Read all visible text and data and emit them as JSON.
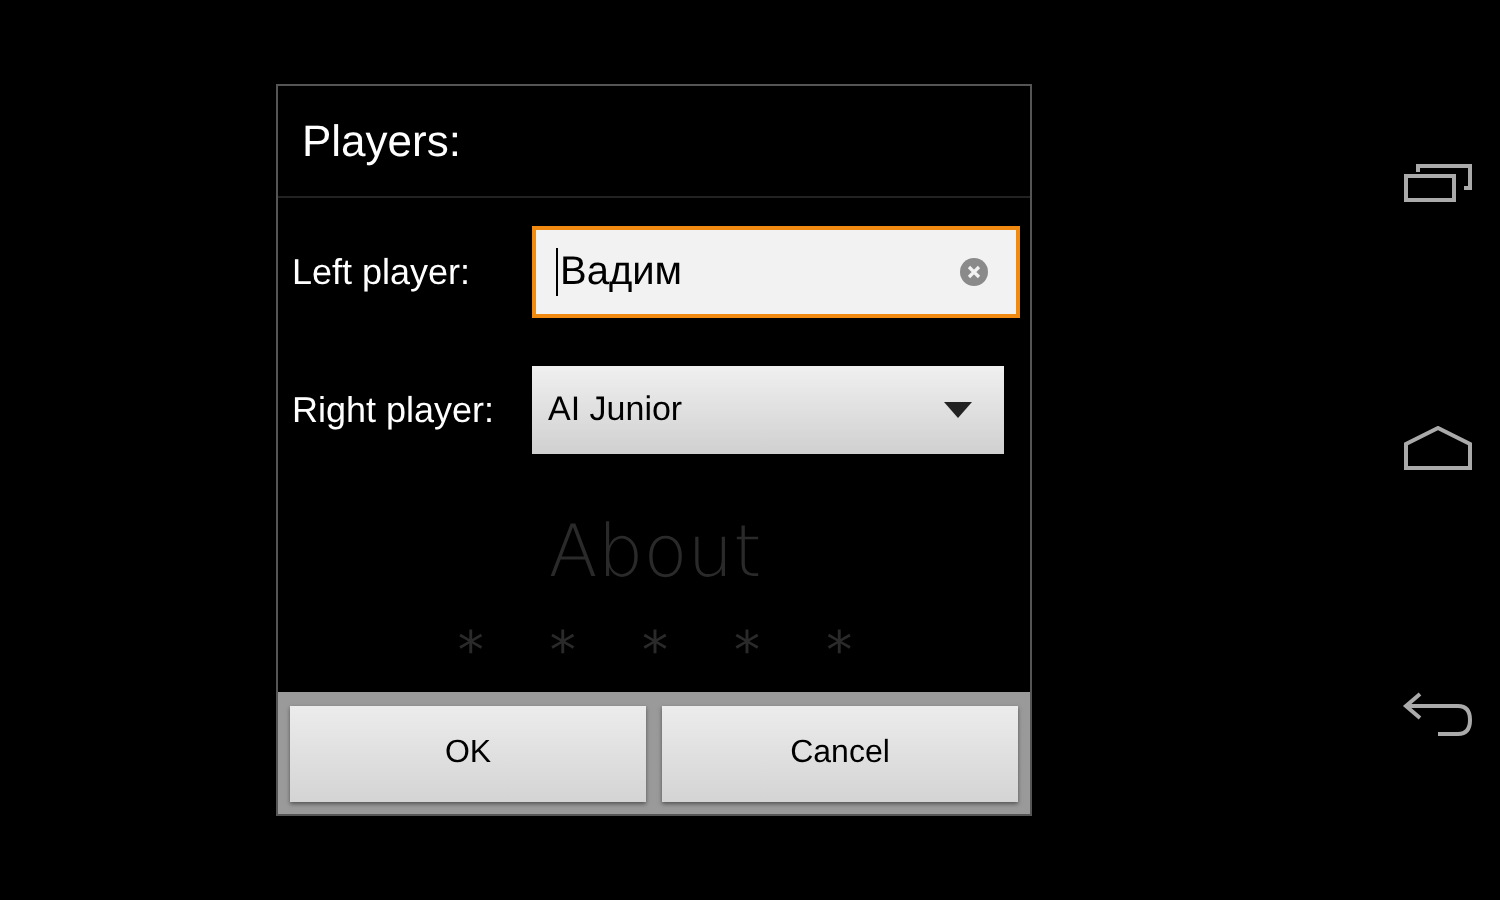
{
  "dialog": {
    "title": "Players:",
    "fields": [
      {
        "kind": "text",
        "label": "Left player:",
        "value": "Вадим",
        "focused": true
      },
      {
        "kind": "dropdown",
        "label": "Right player:",
        "value": "AI Junior",
        "focused": false
      }
    ],
    "buttons": [
      "OK",
      "Cancel"
    ]
  },
  "background_menu": {
    "items": [
      "About"
    ],
    "decoration": "*    *    *    *    *"
  }
}
